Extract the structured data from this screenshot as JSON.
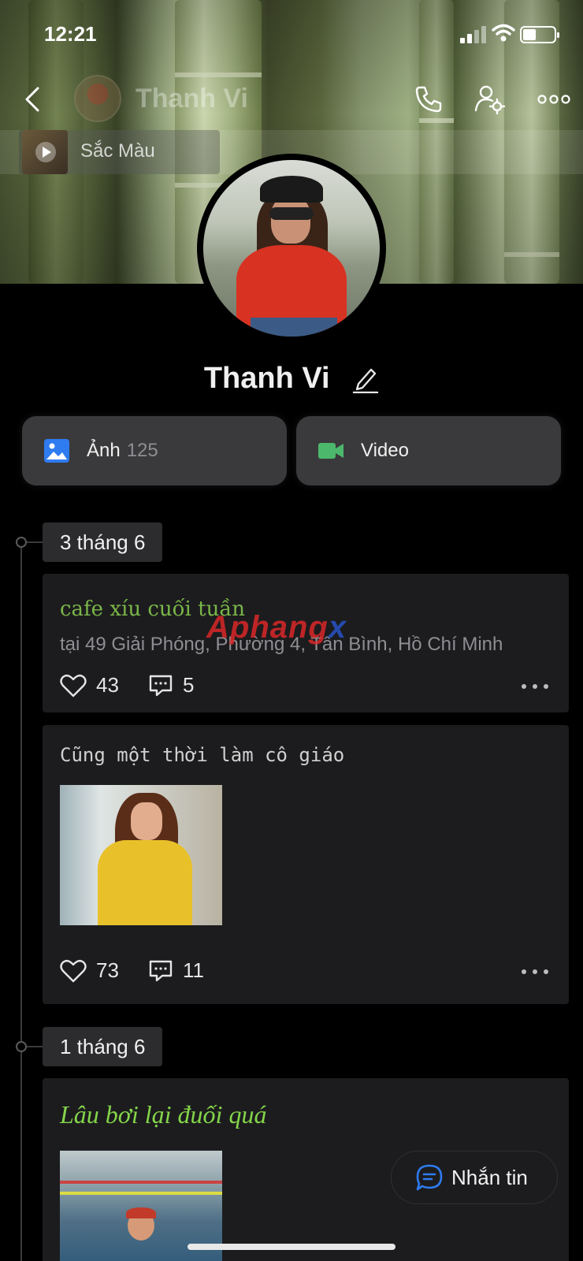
{
  "status_bar": {
    "time": "12:21"
  },
  "header": {
    "name": "Thanh Vi"
  },
  "music": {
    "title": "Sắc Màu"
  },
  "profile": {
    "name": "Thanh Vi"
  },
  "media": {
    "photos_label": "Ảnh",
    "photos_count": "125",
    "video_label": "Video"
  },
  "timeline": [
    {
      "date": "3 tháng 6",
      "posts": [
        {
          "title": "cafe xíu cuối tuần",
          "location": "tại 49 Giải Phóng, Phường 4, Tân Bình, Hồ Chí Minh",
          "likes": "43",
          "comments": "5"
        },
        {
          "title": "Cũng một thời làm cô giáo",
          "likes": "73",
          "comments": "11"
        }
      ]
    },
    {
      "date": "1 tháng 6",
      "posts": [
        {
          "title": "Lâu bơi lại đuối quá"
        }
      ]
    }
  ],
  "watermark": {
    "part1": "Aphang",
    "part2": "x"
  },
  "message_button": {
    "label": "Nhắn tin"
  },
  "colors": {
    "accent_blue": "#2f7bf0",
    "video_green": "#4cb86c",
    "title_green": "#7ab648"
  }
}
